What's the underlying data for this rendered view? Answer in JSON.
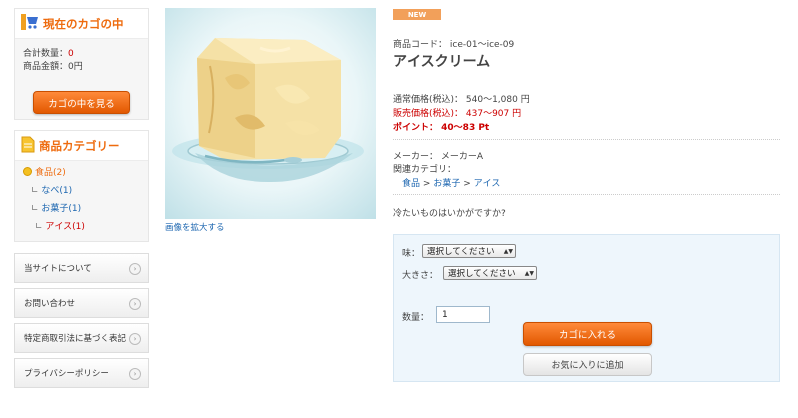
{
  "cart": {
    "title": "現在のカゴの中",
    "qty_label": "合計数量：",
    "qty_value": "0",
    "amount_label": "商品金額：",
    "amount_value": "0円",
    "button": "カゴの中を見る"
  },
  "category": {
    "title": "商品カテゴリー",
    "items": [
      {
        "label": "食品(2)"
      },
      {
        "label": "なべ(1)"
      },
      {
        "label": "お菓子(1)"
      },
      {
        "label": "アイス(1)"
      }
    ]
  },
  "side_links": [
    {
      "label": "当サイトについて"
    },
    {
      "label": "お問い合わせ"
    },
    {
      "label": "特定商取引法に基づく表記"
    },
    {
      "label": "プライバシーポリシー"
    }
  ],
  "product": {
    "zoom_link": "画像を拡大する",
    "badge": "NEW",
    "code_label": "商品コード：",
    "code_value": "ice-01～ice-09",
    "name": "アイスクリーム",
    "regular_price_label": "通常価格(税込)：",
    "regular_price_value": "540～1,080 円",
    "sale_price_label": "販売価格(税込)：",
    "sale_price_value": "437～907 円",
    "point_label": "ポイント：",
    "point_value": "40～83 Pt",
    "maker_label": "メーカー：",
    "maker_value": "メーカーA",
    "related_label": "関連カテゴリ：",
    "crumbs": [
      "食品",
      ">",
      "お菓子",
      ">",
      "アイス"
    ],
    "description": "冷たいものはいかがですか?"
  },
  "order": {
    "taste_label": "味：",
    "taste_value": "選択してください",
    "size_label": "大きさ：",
    "size_value": "選択してください",
    "qty_label": "数量：",
    "qty_value": "1",
    "add_cart_button": "カゴに入れる",
    "favorite_button": "お気に入りに追加"
  }
}
